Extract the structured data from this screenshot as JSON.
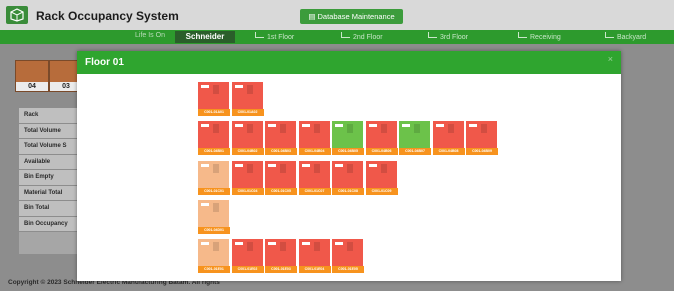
{
  "app": {
    "title": "Rack Occupancy System",
    "db_button": "Database Maintenance"
  },
  "nav": {
    "brand_sub": "Life Is On",
    "brand": "Schneider",
    "items": [
      {
        "label": "1st Floor",
        "icon": "chart-line-icon"
      },
      {
        "label": "2nd Floor",
        "icon": "chart-line-icon"
      },
      {
        "label": "3rd Floor",
        "icon": "chart-line-icon"
      },
      {
        "label": "Receiving",
        "icon": "chart-line-icon"
      },
      {
        "label": "Backyard",
        "icon": "chart-line-icon"
      }
    ]
  },
  "racks": [
    {
      "label": "04"
    },
    {
      "label": "03"
    }
  ],
  "side_table": [
    "Rack",
    "Total Volume",
    "Total Volume S",
    "Available",
    "Bin Empty",
    "Material Total",
    "Bin Total",
    "Bin Occupancy"
  ],
  "modal": {
    "title": "Floor 01",
    "close": "×"
  },
  "colors": {
    "red": "#f0584a",
    "green": "#6cc24a",
    "peach": "#f6b98a",
    "label": "#f7931e"
  },
  "bins": [
    {
      "row": 0,
      "col": 0,
      "color": "red",
      "label": "C001-01A01"
    },
    {
      "row": 0,
      "col": 1,
      "color": "red",
      "label": "C001-01A02"
    },
    {
      "row": 1,
      "col": 0,
      "color": "red",
      "label": "C001-04B01"
    },
    {
      "row": 1,
      "col": 1,
      "color": "red",
      "label": "C001-04B02"
    },
    {
      "row": 1,
      "col": 2,
      "color": "red",
      "label": "C001-04B03"
    },
    {
      "row": 1,
      "col": 3,
      "color": "red",
      "label": "C001-04B04"
    },
    {
      "row": 1,
      "col": 4,
      "color": "green",
      "label": "C001-04B05"
    },
    {
      "row": 1,
      "col": 5,
      "color": "red",
      "label": "C001-04B06"
    },
    {
      "row": 1,
      "col": 6,
      "color": "green",
      "label": "C001-04B07"
    },
    {
      "row": 1,
      "col": 7,
      "color": "red",
      "label": "C001-04B08"
    },
    {
      "row": 1,
      "col": 8,
      "color": "red",
      "label": "C001-04B09"
    },
    {
      "row": 2,
      "col": 0,
      "color": "peach",
      "label": "C001-01C01"
    },
    {
      "row": 2,
      "col": 1,
      "color": "red",
      "label": "C001-01C04"
    },
    {
      "row": 2,
      "col": 2,
      "color": "red",
      "label": "C001-01C05"
    },
    {
      "row": 2,
      "col": 3,
      "color": "red",
      "label": "C001-01C07"
    },
    {
      "row": 2,
      "col": 4,
      "color": "red",
      "label": "C001-01C08"
    },
    {
      "row": 2,
      "col": 5,
      "color": "red",
      "label": "C001-01C09"
    },
    {
      "row": 3,
      "col": 0,
      "color": "peach",
      "label": "C001-04D01"
    },
    {
      "row": 4,
      "col": 0,
      "color": "peach",
      "label": "C001-01E01"
    },
    {
      "row": 4,
      "col": 1,
      "color": "red",
      "label": "C001-01E02"
    },
    {
      "row": 4,
      "col": 2,
      "color": "red",
      "label": "C001-01E03"
    },
    {
      "row": 4,
      "col": 3,
      "color": "red",
      "label": "C001-01E04"
    },
    {
      "row": 4,
      "col": 4,
      "color": "red",
      "label": "C001-01E05"
    }
  ],
  "footer": "Copyright © 2023 Schneider Electric Manufacturing Batam. All rights"
}
